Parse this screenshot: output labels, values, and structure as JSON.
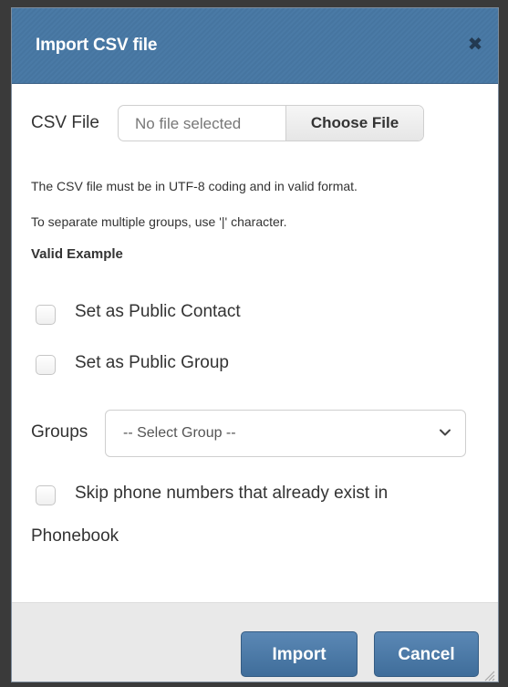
{
  "dialog": {
    "title": "Import CSV file",
    "close_symbol": "✖",
    "icons": {
      "close": "close-icon",
      "dropdown": "chevron-down-icon",
      "resize": "resize-grip-icon"
    }
  },
  "csv": {
    "label": "CSV File",
    "file_name": "No file selected",
    "choose_label": "Choose File"
  },
  "notes": {
    "utf8": "The CSV file must be in UTF-8 coding and in valid format.",
    "separator": "To separate multiple groups, use '|' character.",
    "valid_example": "Valid Example"
  },
  "options": {
    "public_contact": "Set as Public Contact",
    "public_group": "Set as Public Group"
  },
  "groups": {
    "label": "Groups",
    "selected": "-- Select Group --"
  },
  "skip": {
    "line1": "Skip phone numbers that already exist in",
    "line2": "Phonebook"
  },
  "footer": {
    "import_label": "Import",
    "cancel_label": "Cancel"
  },
  "colors": {
    "header": "#4a7aa6",
    "button": "#4a78a6",
    "footer": "#e9e9e9"
  }
}
